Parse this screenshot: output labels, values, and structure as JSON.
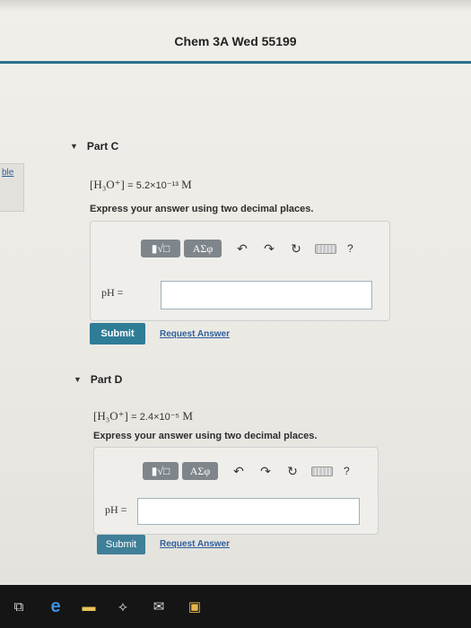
{
  "header": {
    "title": "Chem 3A Wed 55199"
  },
  "side": {
    "link_label": "ble"
  },
  "parts": [
    {
      "title": "Part C",
      "equation": {
        "species": "[H₃O⁺]",
        "equals": "=",
        "value": "5.2×10⁻¹³",
        "unit": "M"
      },
      "instruction": "Express your answer using two decimal places.",
      "toolbar": {
        "matrix_btn": "▮√□",
        "symbol_btn": "ΑΣφ",
        "undo": "↶",
        "redo": "↷",
        "reset": "↻",
        "help": "?"
      },
      "answer_label": "pH =",
      "answer_value": "",
      "submit_label": "Submit",
      "request_label": "Request Answer"
    },
    {
      "title": "Part D",
      "equation": {
        "species": "[H₃O⁺]",
        "equals": "=",
        "value": "2.4×10⁻⁵",
        "unit": "M"
      },
      "instruction": "Express your answer using two decimal places.",
      "toolbar": {
        "matrix_btn": "▮√□",
        "symbol_btn": "ΑΣφ",
        "undo": "↶",
        "redo": "↷",
        "reset": "↻",
        "help": "?"
      },
      "answer_label": "pH =",
      "answer_value": "",
      "submit_label": "Submit",
      "request_label": "Request Answer"
    }
  ],
  "taskbar": {
    "items": [
      {
        "icon": "task-view-icon",
        "glyph": "⧉"
      },
      {
        "icon": "edge-browser-icon",
        "glyph": "e"
      },
      {
        "icon": "file-explorer-icon",
        "glyph": "▬"
      },
      {
        "icon": "dropbox-icon",
        "glyph": "⟡"
      },
      {
        "icon": "mail-icon",
        "glyph": "✉"
      },
      {
        "icon": "store-icon",
        "glyph": "▣"
      }
    ]
  },
  "colors": {
    "accent": "#2c6f8e",
    "submit": "#2f7c96",
    "link": "#2d5f9a",
    "toolbar_btn": "#7f868b"
  }
}
